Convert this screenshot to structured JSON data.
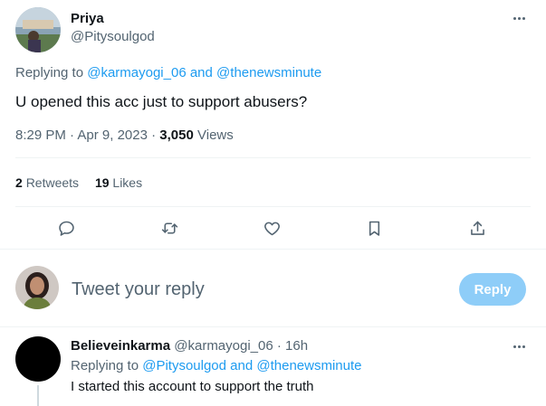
{
  "tweet": {
    "author_name": "Priya",
    "author_handle": "@Pitysoulgod",
    "replying_prefix": "Replying to",
    "replying_to_1": "@karmayogi_06",
    "replying_and": "and",
    "replying_to_2": "@thenewsminute",
    "text": "U opened this acc just to support abusers?",
    "time": "8:29 PM",
    "sep": "·",
    "date": "Apr 9, 2023",
    "views_count": "3,050",
    "views_label": "Views"
  },
  "stats": {
    "retweets_count": "2",
    "retweets_label": "Retweets",
    "likes_count": "19",
    "likes_label": "Likes"
  },
  "actions": [
    "reply-icon",
    "retweet-icon",
    "like-icon",
    "bookmark-icon",
    "share-icon"
  ],
  "composer": {
    "placeholder": "Tweet your reply",
    "button_label": "Reply"
  },
  "reply": {
    "author_name": "Believeinkarma",
    "author_handle": "@karmayogi_06",
    "sep": "·",
    "time_ago": "16h",
    "replying_prefix": "Replying to",
    "replying_to_1": "@Pitysoulgod",
    "replying_and": "and",
    "replying_to_2": "@thenewsminute",
    "text": "I started this account to support the truth"
  },
  "colors": {
    "accent": "#1d9bf0",
    "muted_text": "#536471",
    "reply_button_disabled": "#8ecdf8"
  }
}
